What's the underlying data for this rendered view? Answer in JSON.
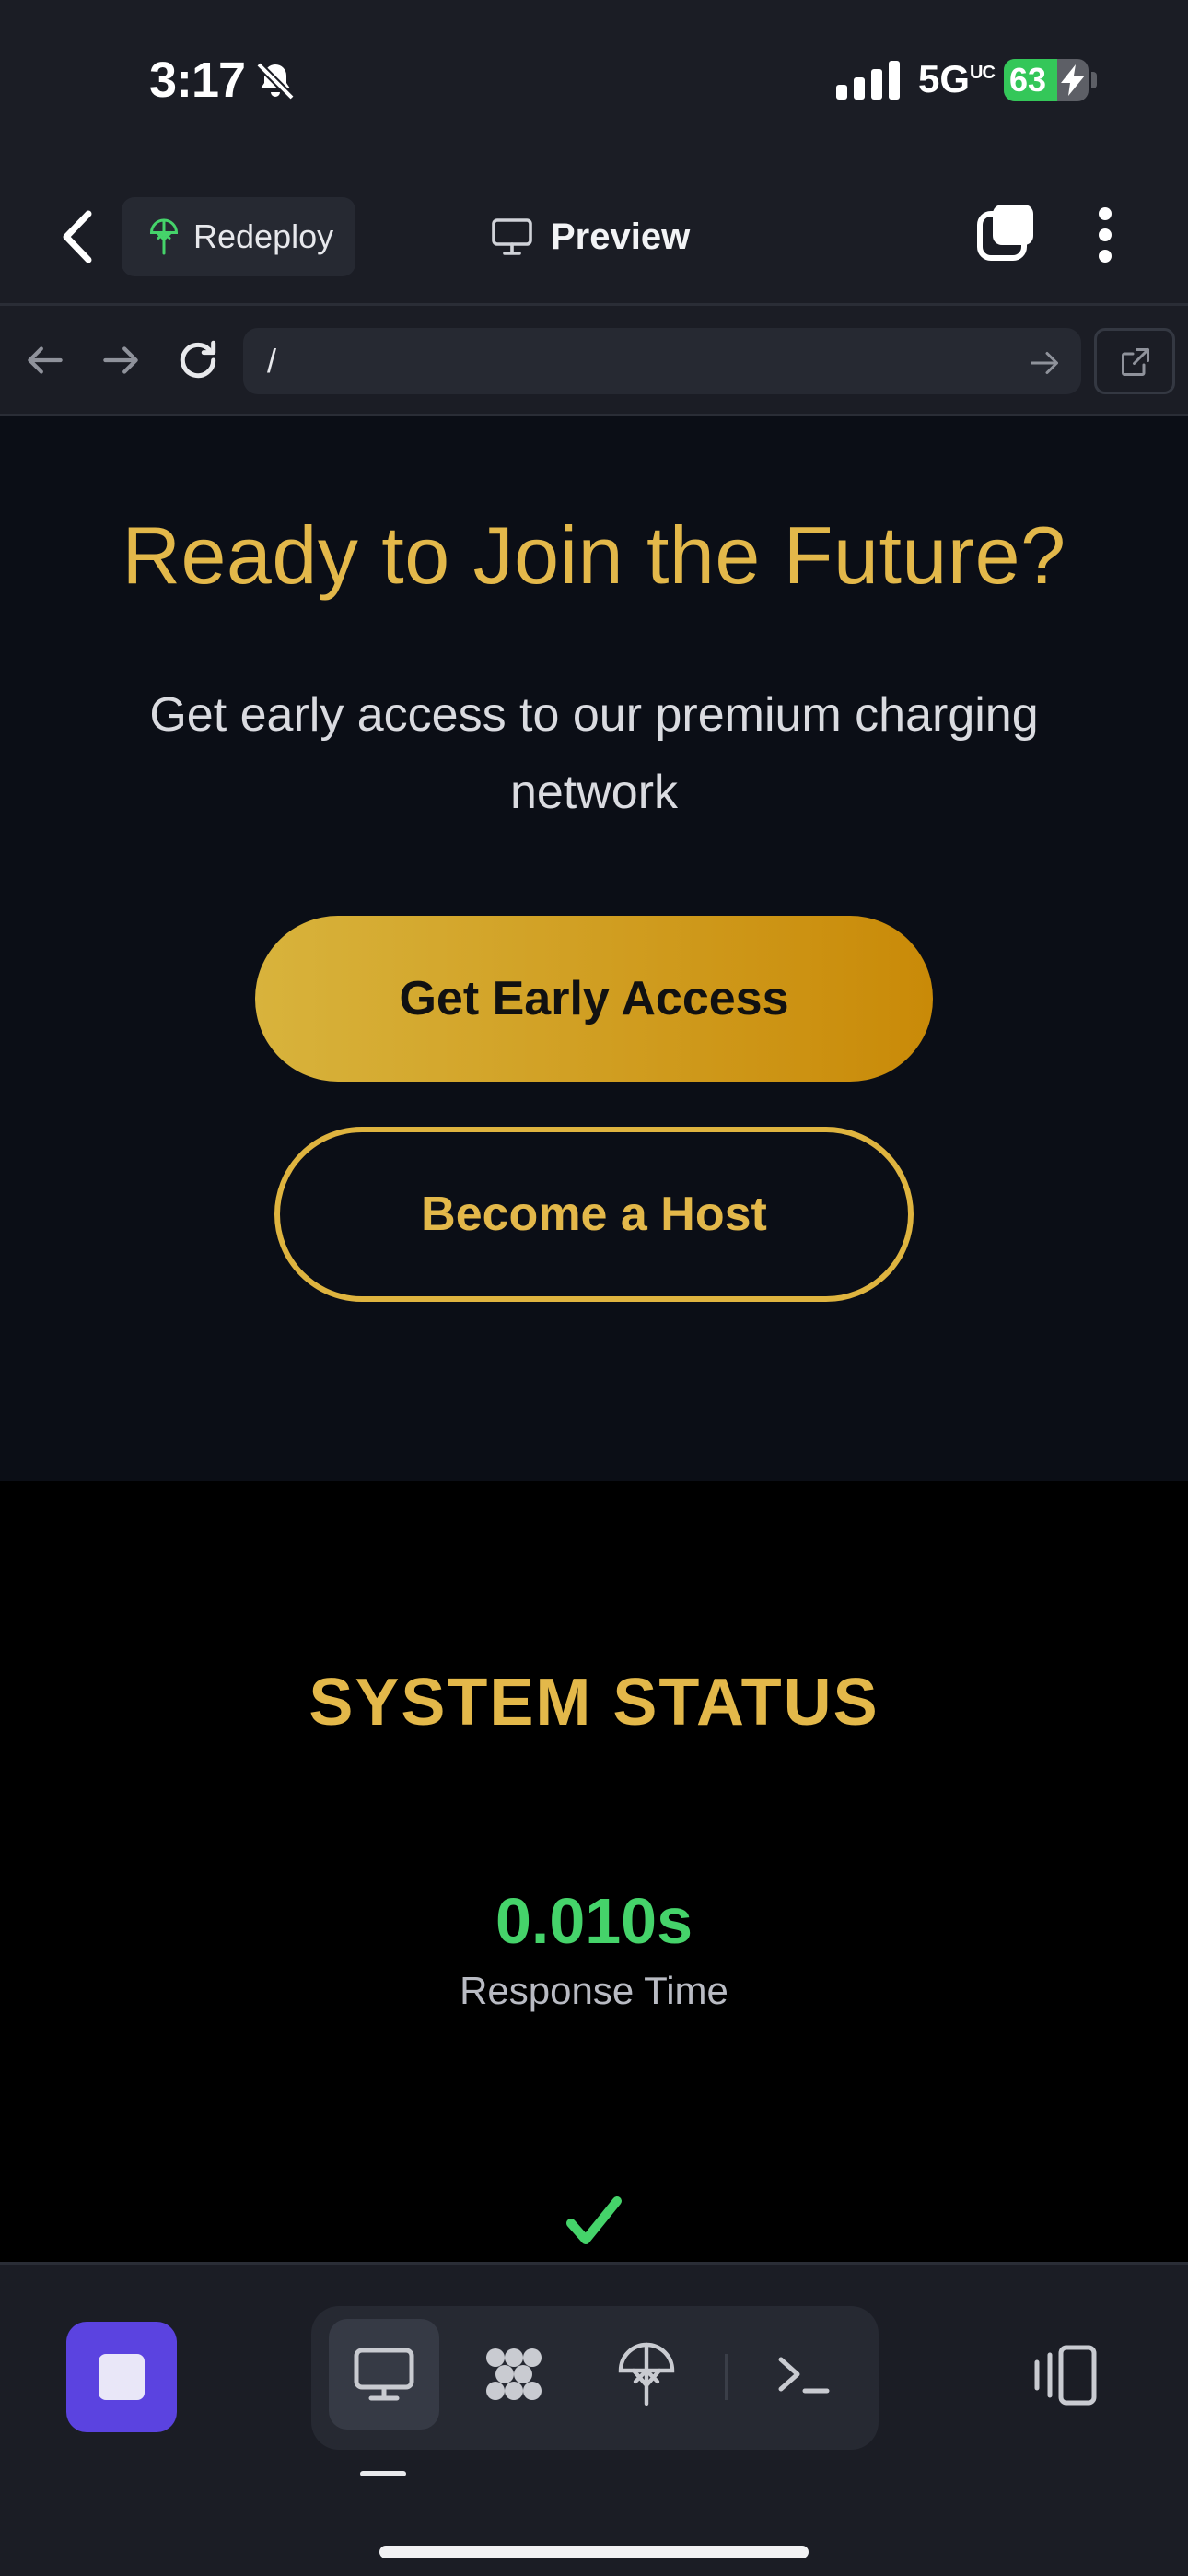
{
  "status_bar": {
    "time": "3:17",
    "network": "5G",
    "network_sup": "UC",
    "battery": "63",
    "battery_level": 0.63,
    "battery_color": "#34c759"
  },
  "header": {
    "redeploy_label": "Redeploy",
    "preview_label": "Preview",
    "icons": [
      "back-chevron-icon",
      "redeploy-icon",
      "monitor-icon",
      "tabs-icon",
      "more-vertical-icon"
    ]
  },
  "url_bar": {
    "value": "/",
    "icons": [
      "arrow-left-icon",
      "arrow-right-icon",
      "reload-icon",
      "go-arrow-icon",
      "open-external-icon"
    ]
  },
  "page": {
    "cta": {
      "title": "Ready to Join the Future?",
      "subtitle": "Get early access to our premium charging network",
      "primary_button": "Get Early Access",
      "secondary_button": "Become a Host",
      "accent_color": "#e3b84a"
    },
    "system_status": {
      "title": "SYSTEM STATUS",
      "metric_value": "0.010s",
      "metric_label": "Response Time",
      "metric_color": "#45d36a",
      "indicator_icon": "check-icon"
    }
  },
  "bottom_toolbar": {
    "stop_color": "#5b43e0",
    "tabs": [
      "preview-monitor-icon",
      "modules-icon",
      "deploy-icon",
      "terminal-icon"
    ],
    "active_tab": "preview-monitor-icon",
    "layout_icon": "layout-toggle-icon"
  }
}
